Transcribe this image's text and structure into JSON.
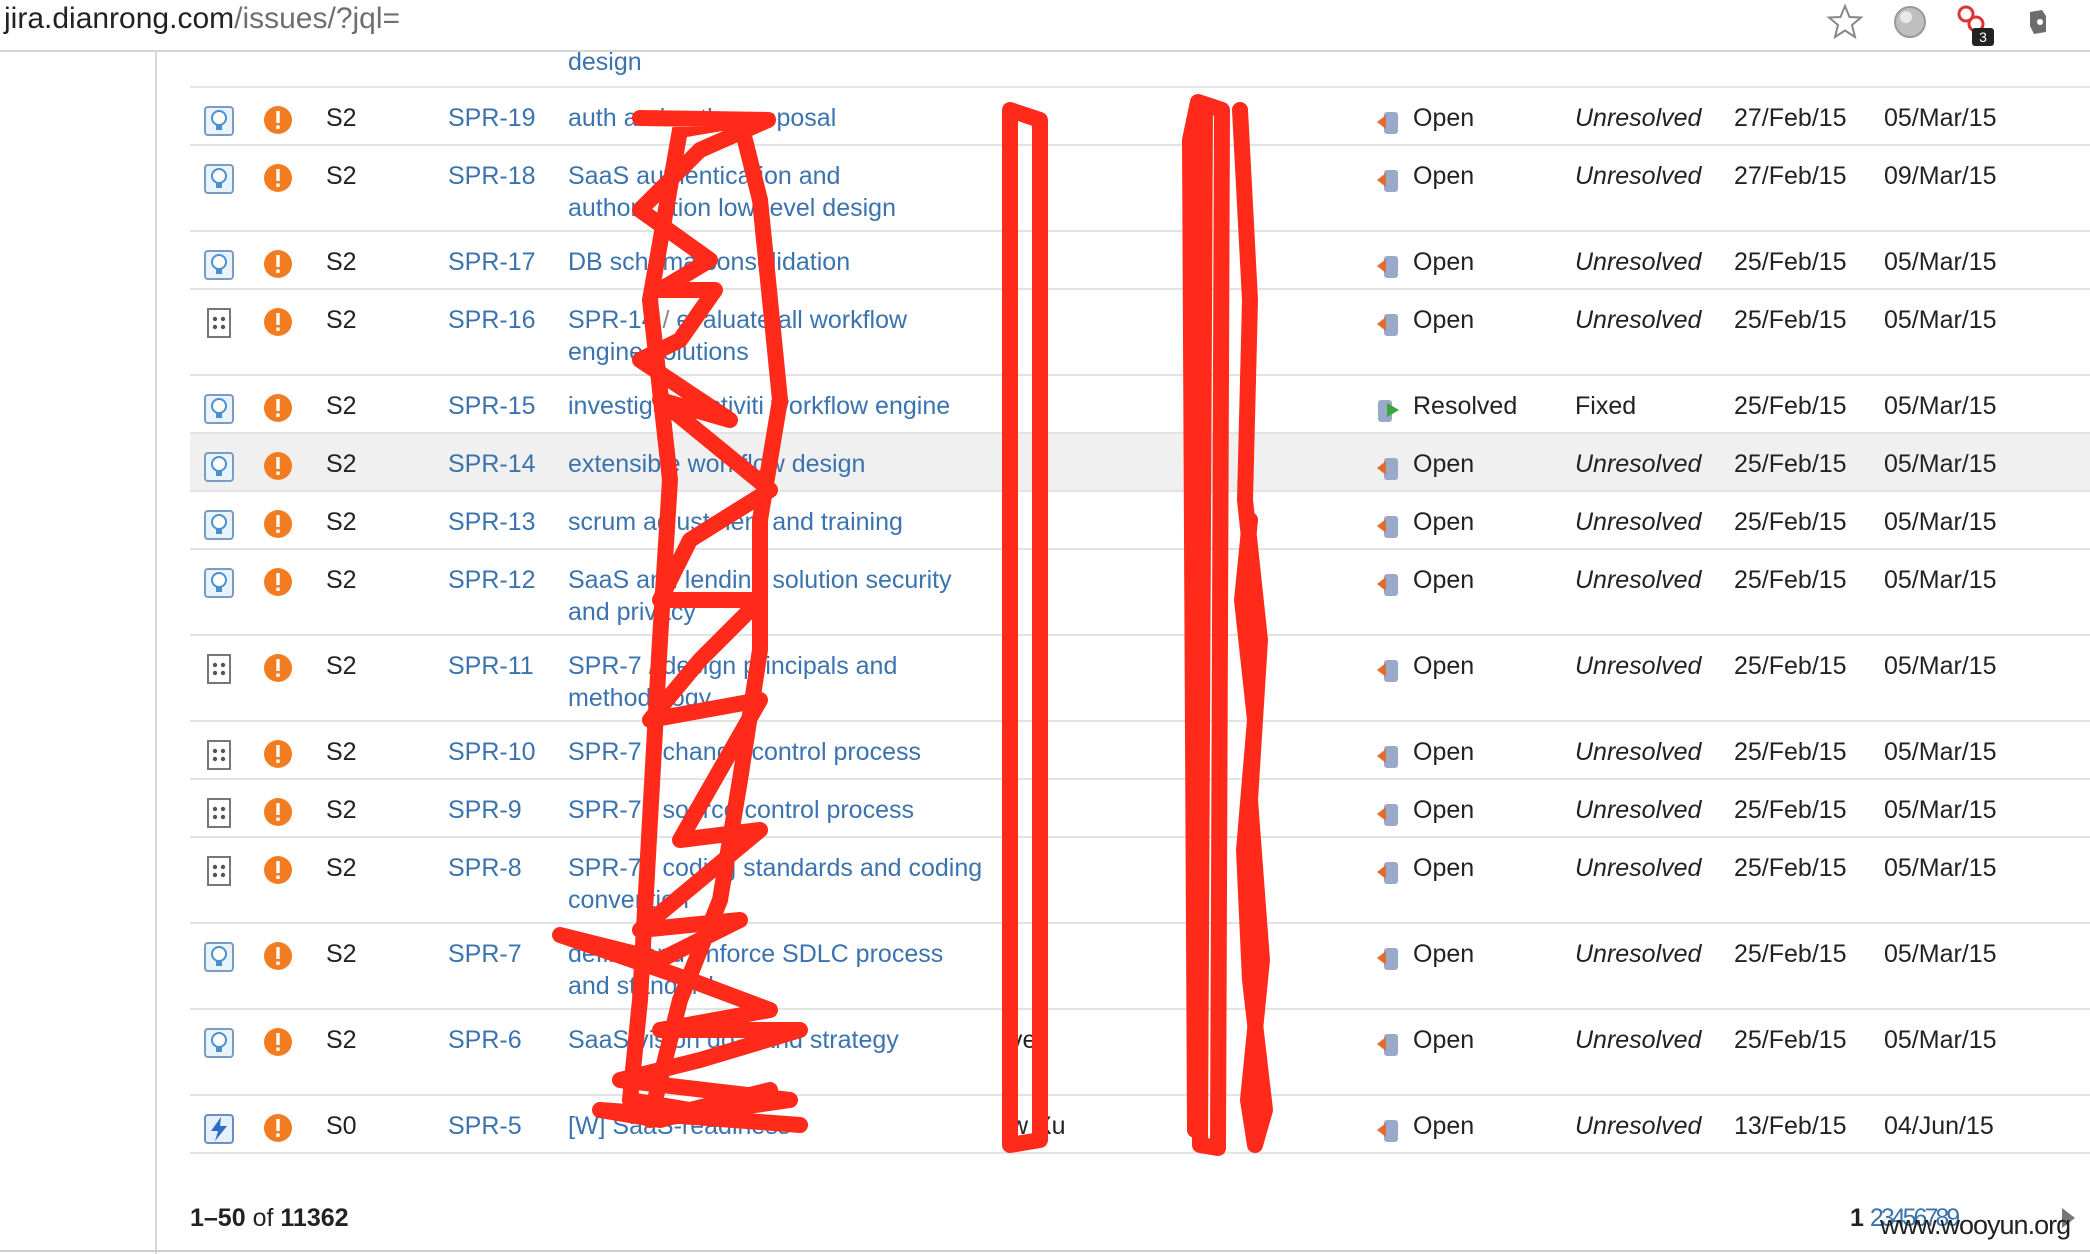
{
  "browser": {
    "url_host": "jira.dianrong.com",
    "url_path": "/issues/?jql=",
    "extension_badge": "3",
    "icons": [
      "bookmark-star-icon",
      "globe-extension-icon",
      "extension-icon",
      "evernote-icon"
    ]
  },
  "issues": {
    "partial_row_summary": "design",
    "rows": [
      {
        "type": "improvement",
        "severity": "S2",
        "key": "SPR-19",
        "summary": "auth and authz proposal",
        "assignee": "",
        "reporter": "",
        "status": "Open",
        "resolution": "Unresolved",
        "created": "27/Feb/15",
        "updated": "05/Mar/15",
        "height": "h1"
      },
      {
        "type": "improvement",
        "severity": "S2",
        "key": "SPR-18",
        "summary": "SaaS authentication and authorization low-level design",
        "assignee": "",
        "reporter": "",
        "status": "Open",
        "resolution": "Unresolved",
        "created": "27/Feb/15",
        "updated": "09/Mar/15",
        "height": "h2"
      },
      {
        "type": "improvement",
        "severity": "S2",
        "key": "SPR-17",
        "summary": "DB schema consolidation",
        "assignee": "",
        "reporter": "",
        "status": "Open",
        "resolution": "Unresolved",
        "created": "25/Feb/15",
        "updated": "05/Mar/15",
        "height": "h1"
      },
      {
        "type": "subtask",
        "severity": "S2",
        "key": "SPR-16",
        "summary": "SPR-14 / evaluate all workflow engine solutions",
        "assignee": "",
        "reporter": "",
        "status": "Open",
        "resolution": "Unresolved",
        "created": "25/Feb/15",
        "updated": "05/Mar/15",
        "height": "h2"
      },
      {
        "type": "improvement",
        "severity": "S2",
        "key": "SPR-15",
        "summary": "investigate activiti workflow engine",
        "assignee": "",
        "reporter": "",
        "status": "Resolved",
        "resolution": "Fixed",
        "created": "25/Feb/15",
        "updated": "05/Mar/15",
        "height": "h1"
      },
      {
        "type": "improvement",
        "severity": "S2",
        "key": "SPR-14",
        "summary": "extensible workflow design",
        "assignee": "",
        "reporter": "",
        "status": "Open",
        "resolution": "Unresolved",
        "created": "25/Feb/15",
        "updated": "05/Mar/15",
        "height": "h1",
        "highlight": true
      },
      {
        "type": "improvement",
        "severity": "S2",
        "key": "SPR-13",
        "summary": "scrum adjustment and training",
        "assignee": "",
        "reporter": "",
        "status": "Open",
        "resolution": "Unresolved",
        "created": "25/Feb/15",
        "updated": "05/Mar/15",
        "height": "h1"
      },
      {
        "type": "improvement",
        "severity": "S2",
        "key": "SPR-12",
        "summary": "SaaS and lending solution security and privacy",
        "assignee": "",
        "reporter": "",
        "status": "Open",
        "resolution": "Unresolved",
        "created": "25/Feb/15",
        "updated": "05/Mar/15",
        "height": "h2"
      },
      {
        "type": "subtask",
        "severity": "S2",
        "key": "SPR-11",
        "summary": "SPR-7 / design principals and methodology",
        "assignee": "",
        "reporter": "",
        "status": "Open",
        "resolution": "Unresolved",
        "created": "25/Feb/15",
        "updated": "05/Mar/15",
        "height": "h2"
      },
      {
        "type": "subtask",
        "severity": "S2",
        "key": "SPR-10",
        "summary": "SPR-7 / change control process",
        "assignee": "",
        "reporter": "",
        "status": "Open",
        "resolution": "Unresolved",
        "created": "25/Feb/15",
        "updated": "05/Mar/15",
        "height": "h1"
      },
      {
        "type": "subtask",
        "severity": "S2",
        "key": "SPR-9",
        "summary": "SPR-7 / source control process",
        "assignee": "",
        "reporter": "",
        "status": "Open",
        "resolution": "Unresolved",
        "created": "25/Feb/15",
        "updated": "05/Mar/15",
        "height": "h1"
      },
      {
        "type": "subtask",
        "severity": "S2",
        "key": "SPR-8",
        "summary": "SPR-7 / coding standards and coding convention",
        "assignee": "",
        "reporter": "",
        "status": "Open",
        "resolution": "Unresolved",
        "created": "25/Feb/15",
        "updated": "05/Mar/15",
        "height": "h2"
      },
      {
        "type": "improvement",
        "severity": "S2",
        "key": "SPR-7",
        "summary": "define and enforce SDLC process and standard",
        "assignee": "",
        "reporter": "",
        "status": "Open",
        "resolution": "Unresolved",
        "created": "25/Feb/15",
        "updated": "05/Mar/15",
        "height": "h2"
      },
      {
        "type": "improvement",
        "severity": "S2",
        "key": "SPR-6",
        "summary": "SaaS vision goal and strategy",
        "assignee": "ve)",
        "reporter": "",
        "status": "Open",
        "resolution": "Unresolved",
        "created": "25/Feb/15",
        "updated": "05/Mar/15",
        "height": "h2"
      },
      {
        "type": "epic",
        "severity": "S0",
        "key": "SPR-5",
        "summary": "[W] SaaS-readiness",
        "assignee": "w Xu",
        "reporter": "",
        "status": "Open",
        "resolution": "Unresolved",
        "created": "13/Feb/15",
        "updated": "04/Jun/15",
        "height": "h1"
      }
    ]
  },
  "footer": {
    "range": "1–50",
    "of": "of",
    "total": "11362",
    "current_page": "1",
    "other_pages": [
      "2",
      "3",
      "4",
      "5",
      "6",
      "7",
      "8",
      "9"
    ],
    "watermark": "www.wooyun.org"
  },
  "colors": {
    "link": "#3b73af",
    "priority": "#f47c20",
    "redaction": "#ff2a1a",
    "row_highlight": "#f0f0f0"
  }
}
